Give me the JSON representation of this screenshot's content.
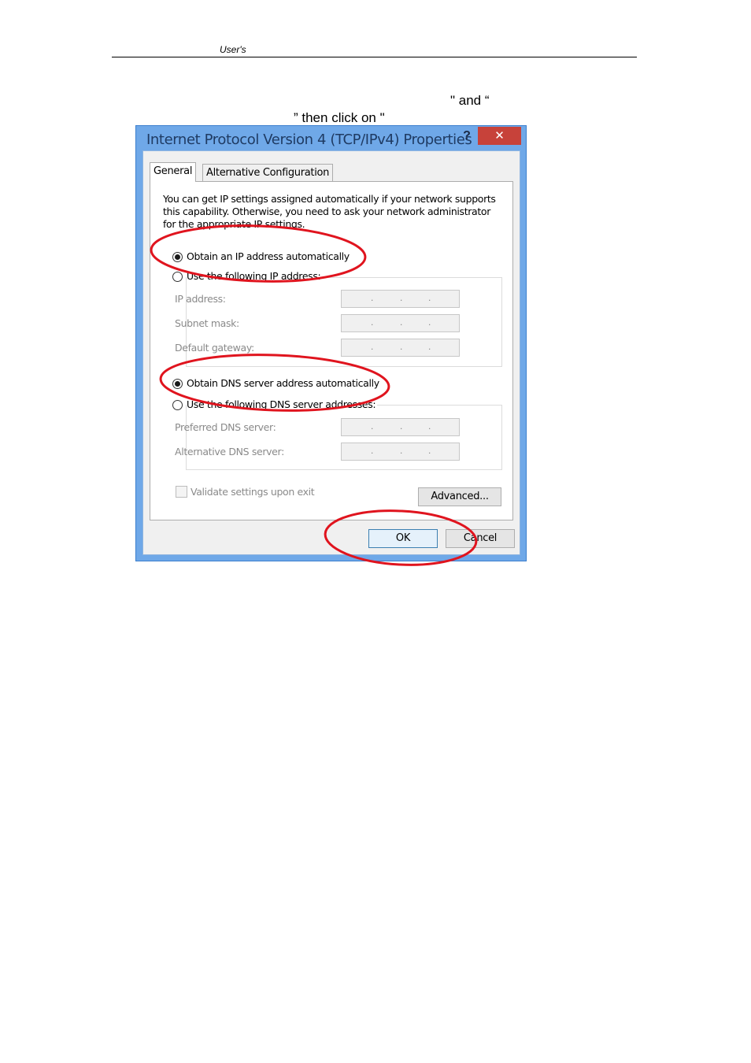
{
  "page_header": {
    "text": "User's"
  },
  "instruction": {
    "line1": "\" and “",
    "line2": "” then click on \""
  },
  "dialog": {
    "title": "Internet Protocol Version 4 (TCP/IPv4) Properties",
    "help_glyph": "?",
    "close_glyph": "✕",
    "tabs": [
      "General",
      "Alternative Configuration"
    ],
    "description": [
      "You can get IP settings assigned automatically if your network supports",
      "this capability. Otherwise, you need to ask your network administrator",
      "for the appropriate IP settings."
    ],
    "ip_auto_label": "Obtain an IP address automatically",
    "ip_manual_label": "Use the following IP address:",
    "ip_fields": [
      "IP address:",
      "Subnet mask:",
      "Default gateway:"
    ],
    "dns_auto_label": "Obtain DNS server address automatically",
    "dns_manual_label": "Use the following DNS server addresses:",
    "dns_fields": [
      "Preferred DNS server:",
      "Alternative DNS server:"
    ],
    "ip_separator": ".",
    "validate_label": "Validate settings upon exit",
    "advanced_button": "Advanced...",
    "ok_button": "OK",
    "cancel_button": "Cancel",
    "selected": {
      "ip": "automatic",
      "dns": "automatic",
      "validate": false
    }
  },
  "colors": {
    "annotation": "#e0141e",
    "title_bar": "#6fa8e8",
    "close_button": "#c7423a"
  },
  "icons": [
    "help-icon",
    "close-icon"
  ]
}
